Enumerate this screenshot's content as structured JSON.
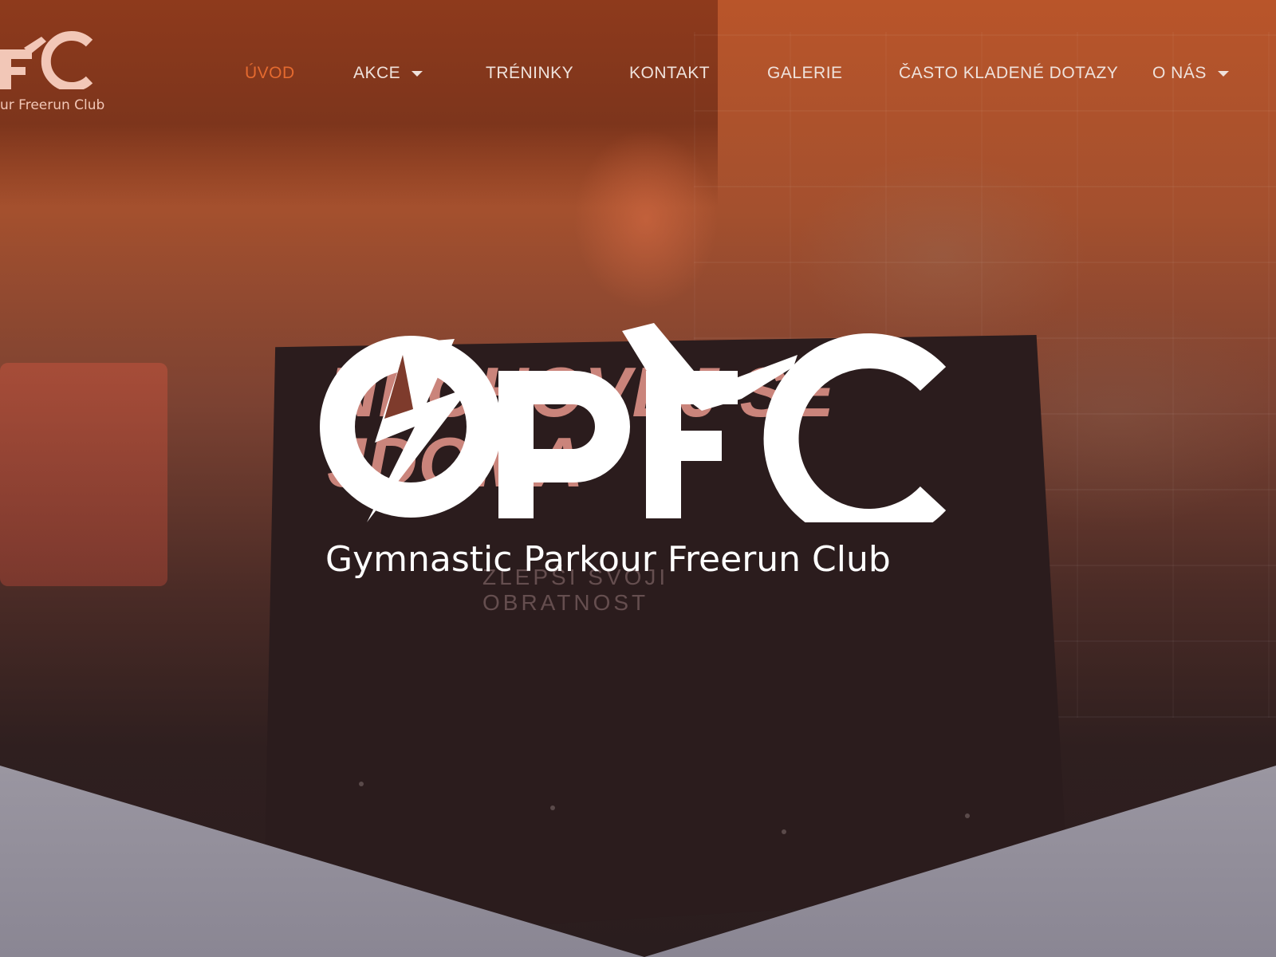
{
  "brand": {
    "small_logo_caption": "ur Freerun Club",
    "big_logo_caption": "Gymnastic Parkour Freerun Club",
    "logo_letters": "GPFC"
  },
  "nav": {
    "items": [
      {
        "label": "ÚVOD",
        "active": true,
        "has_dropdown": false
      },
      {
        "label": "AKCE",
        "active": false,
        "has_dropdown": true
      },
      {
        "label": "TRÉNINKY",
        "active": false,
        "has_dropdown": false
      },
      {
        "label": "KONTAKT",
        "active": false,
        "has_dropdown": false
      },
      {
        "label": "GALERIE",
        "active": false,
        "has_dropdown": false
      },
      {
        "label": "ČASTO KLADENÉ DOTAZY",
        "active": false,
        "has_dropdown": false
      },
      {
        "label": "O NÁS",
        "active": false,
        "has_dropdown": true
      }
    ]
  },
  "hero": {
    "headline": "NECHOVEJ SE\nJDOMA",
    "tagline": "ZLEPŠI SVOJI OBRATNOST"
  },
  "colors": {
    "accent": "#e46a2f",
    "nav_text": "#efe2dc",
    "logo_white": "#ffffff",
    "bottom_band": "#9a96a1"
  }
}
